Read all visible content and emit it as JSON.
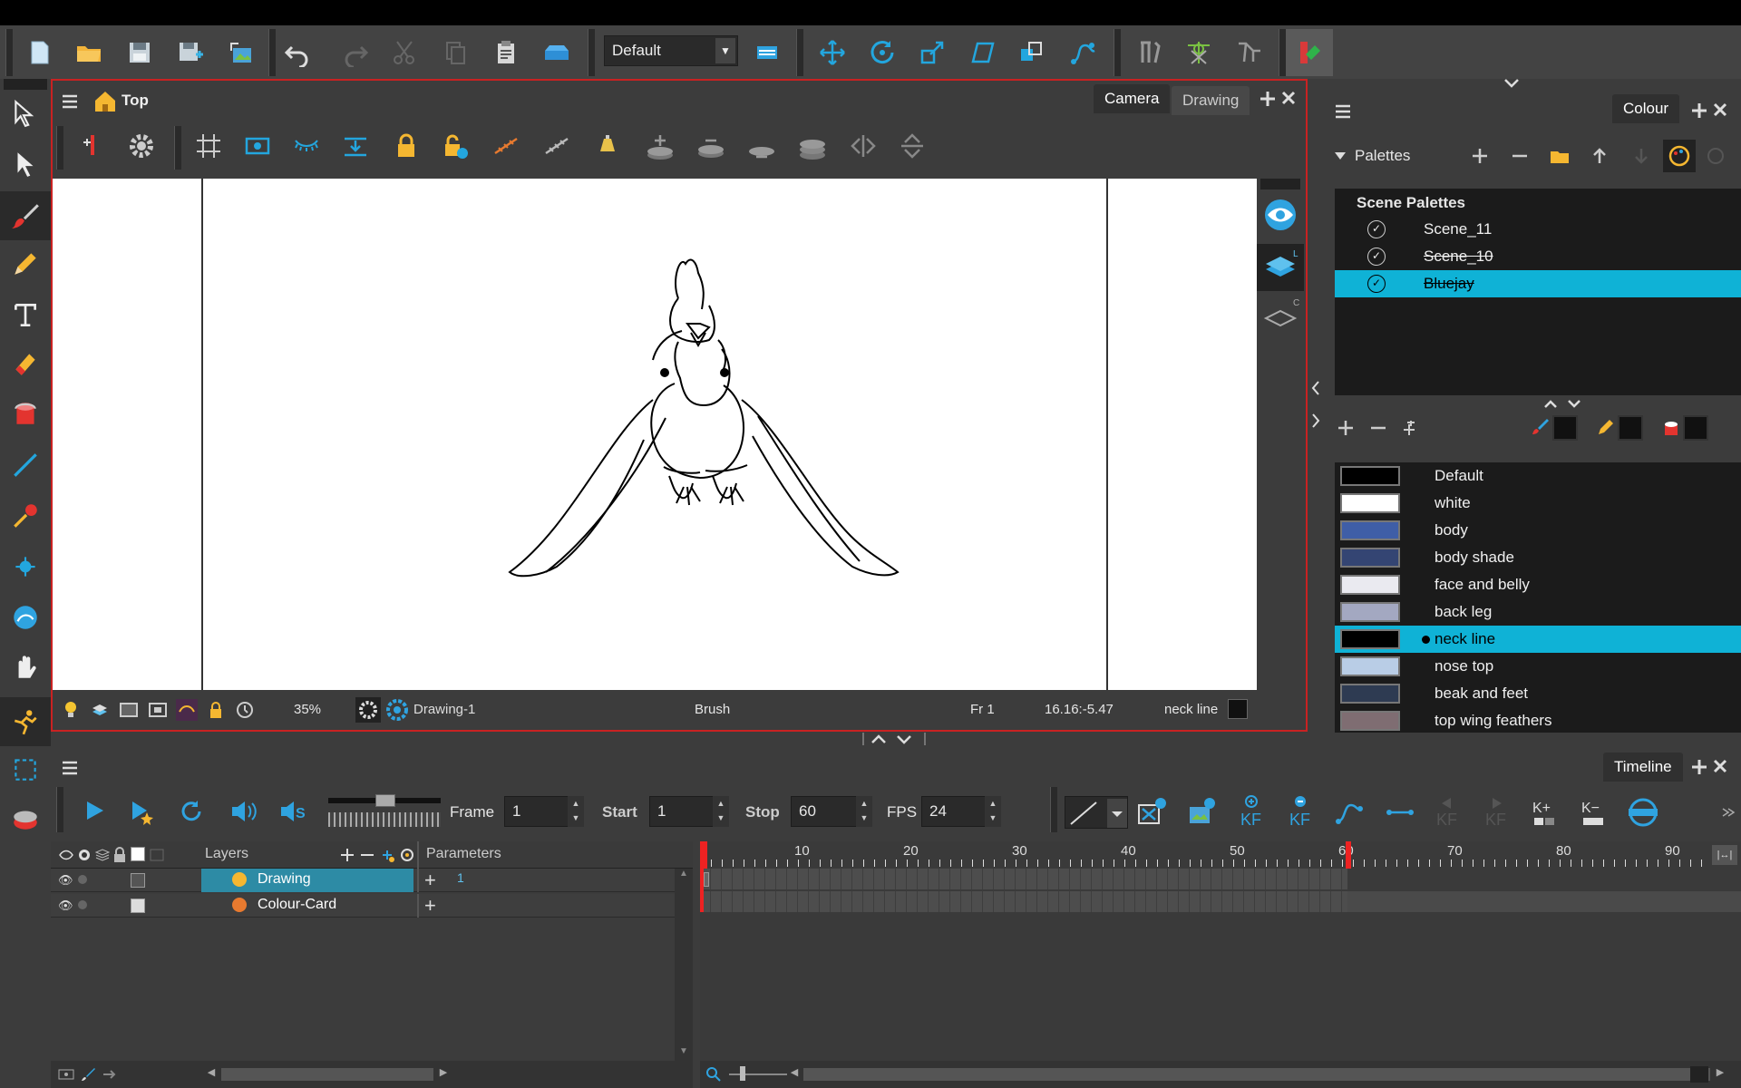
{
  "toolbar": {
    "workspace": "Default"
  },
  "camera_view": {
    "title": "Top",
    "tabs": [
      "Camera",
      "Drawing"
    ],
    "zoom": "35%",
    "drawing_name": "Drawing-1",
    "tool": "Brush",
    "frame": "Fr 1",
    "coords": "16.16:-5.47",
    "colour": "neck line"
  },
  "colour_panel": {
    "tab": "Colour",
    "palettes_label": "Palettes",
    "scene_palettes_label": "Scene Palettes",
    "palettes": [
      {
        "name": "Scene_11",
        "strike": false,
        "selected": false
      },
      {
        "name": "Scene_10",
        "strike": true,
        "selected": false
      },
      {
        "name": "Bluejay",
        "strike": true,
        "selected": true
      }
    ],
    "colours": [
      {
        "name": "Default",
        "color": "#000000",
        "selected": false
      },
      {
        "name": "white",
        "color": "#ffffff",
        "selected": false
      },
      {
        "name": "body",
        "color": "#3f5ea7",
        "selected": false
      },
      {
        "name": "body shade",
        "color": "#344573",
        "selected": false
      },
      {
        "name": "face and belly",
        "color": "#eaeaf0",
        "selected": false
      },
      {
        "name": "back leg",
        "color": "#a3a8c1",
        "selected": false
      },
      {
        "name": "neck line",
        "color": "#000000",
        "selected": true
      },
      {
        "name": "nose top",
        "color": "#b9cde6",
        "selected": false
      },
      {
        "name": "beak and feet",
        "color": "#2e3b52",
        "selected": false
      },
      {
        "name": "top wing feathers",
        "color": "#7f6d72",
        "selected": false
      }
    ]
  },
  "timeline": {
    "tab": "Timeline",
    "frame_label": "Frame",
    "frame": "1",
    "start_label": "Start",
    "start": "1",
    "stop_label": "Stop",
    "stop": "60",
    "fps_label": "FPS",
    "fps": "24",
    "layers_label": "Layers",
    "parameters_label": "Parameters",
    "layers": [
      {
        "name": "Drawing",
        "selected": true,
        "param": "1"
      },
      {
        "name": "Colour-Card",
        "selected": false,
        "param": ""
      }
    ],
    "ruler": [
      "10",
      "20",
      "30",
      "40",
      "50",
      "60",
      "70",
      "80",
      "90"
    ]
  }
}
